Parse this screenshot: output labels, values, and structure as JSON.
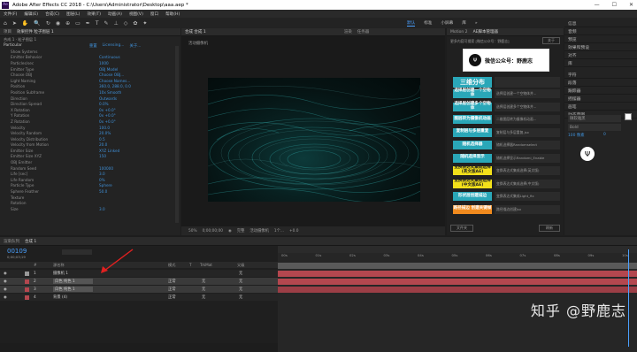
{
  "window": {
    "title": "Adobe After Effects CC 2018 - C:\\Users\\Administrator\\Desktop\\aaa.aep *",
    "logo": "Ae",
    "controls": [
      "—",
      "☐",
      "✕"
    ]
  },
  "menu": [
    "文件(F)",
    "编辑(E)",
    "合成(C)",
    "图层(L)",
    "效果(T)",
    "动画(A)",
    "视图(V)",
    "窗口",
    "帮助(H)"
  ],
  "workspaces": [
    "默认",
    "标准",
    "小屏幕",
    "库",
    "»"
  ],
  "effects_panel": {
    "tab_project": "项目",
    "tab_effects": "效果控件 粒子图层 1",
    "header": "合成 1 · 粒子图层 1",
    "effect_name": "Particular",
    "effect_links": [
      "重置",
      "Licensing...",
      "关于..."
    ],
    "props": [
      {
        "name": "Show Systems",
        "val": ""
      },
      {
        "name": "Emitter Behavior",
        "val": "Continuous"
      },
      {
        "name": "Particles/sec",
        "val": "1000"
      },
      {
        "name": "Emitter Type",
        "val": "OBJ Model"
      },
      {
        "name": "Choose OBJ",
        "val": "Choose OBJ..."
      },
      {
        "name": "Light Naming",
        "val": "Choose Names..."
      },
      {
        "name": "Position",
        "val": "360.0, 288.0, 0.0"
      },
      {
        "name": "Position Subframe",
        "val": "10x Smooth"
      },
      {
        "name": "Direction",
        "val": "Outwards"
      },
      {
        "name": "Direction Spread",
        "val": "0.0%"
      },
      {
        "name": "X Rotation",
        "val": "0x +0.0°"
      },
      {
        "name": "Y Rotation",
        "val": "0x +0.0°"
      },
      {
        "name": "Z Rotation",
        "val": "0x +0.0°"
      },
      {
        "name": "Velocity",
        "val": "100.0"
      },
      {
        "name": "Velocity Random",
        "val": "20.0%"
      },
      {
        "name": "Velocity Distribution",
        "val": "0.5"
      },
      {
        "name": "Velocity from Motion",
        "val": "20.0"
      },
      {
        "name": "Emitter Size",
        "val": "XYZ Linked"
      },
      {
        "name": "Emitter Size XYZ",
        "val": "150"
      },
      {
        "name": "OBJ Emitter",
        "val": ""
      },
      {
        "name": "Random Seed",
        "val": "100000"
      },
      {
        "name": "Life [sec]",
        "val": "3.0"
      },
      {
        "name": "Life Random",
        "val": "0%"
      },
      {
        "name": "Particle Type",
        "val": "Sphere"
      },
      {
        "name": "Sphere Feather",
        "val": "50.0"
      },
      {
        "name": "Texture",
        "val": ""
      },
      {
        "name": "Rotation",
        "val": ""
      },
      {
        "name": "Size",
        "val": "3.0"
      }
    ]
  },
  "comp_panel": {
    "tab": "合成 合成 1",
    "tab_extra": [
      "渲染",
      "任务器"
    ],
    "label": "活动摄像机",
    "footer": [
      "50%",
      "0;00;00;00",
      "完整",
      "活动摄像机",
      "1个...",
      "+0.0"
    ]
  },
  "plugin_panel": {
    "tab1": "Motion 2",
    "tab2": "AE脚本管理器",
    "header": "更多内容可搜索 [微信公众号：野鹿志]",
    "about": "关于",
    "wechat_label": "微信公众号：野鹿志",
    "title_btn": "三维分布",
    "items": [
      {
        "label": "选择层创建一个空物体",
        "desc": "选择层创建一个空物体并...",
        "color": "#2aa7b8"
      },
      {
        "label": "选择层创建多个空物体",
        "desc": "选择层创建多个空物体并...",
        "color": "#2aa7b8"
      },
      {
        "label": "图层转为摄像机动画",
        "desc": "二维图层转为摄像机动画...",
        "color": "#2aa7b8"
      },
      {
        "label": "复制层与多层重复",
        "desc": "复制层与多层重复.jsx",
        "color": "#2aa7b8"
      },
      {
        "label": "随机选择器",
        "desc": "随机选择器Randomselect",
        "color": "#2aa7b8"
      },
      {
        "label": "随机选择显示",
        "desc": "随机选择显示Randomi_Enable",
        "color": "#2aa7b8"
      },
      {
        "label": "变换表达式集成选择(英文版AE)",
        "desc": "变换表达式集成选择(英文版)",
        "color": "#f2e01a"
      },
      {
        "label": "变换表达式集成选择(中文版AE)",
        "desc": "变换表达式集成选择(中文版)",
        "color": "#f2e01a"
      },
      {
        "label": "形状层创建描边",
        "desc": "变换表达式集成Light_fix",
        "color": "#2aa7b8"
      },
      {
        "label": "路径描边 创建关键帧",
        "desc": "路径描边创建jsx",
        "color": "#f08a1e"
      }
    ],
    "footer_left": "文件夹",
    "footer_right": "刷新"
  },
  "right_panel": {
    "items": [
      "信息",
      "音频",
      "预览",
      "效果和预设",
      "对齐",
      "库",
      "字符",
      "段落",
      "跟踪器",
      "摇摆器",
      "画笔",
      "动态草图"
    ],
    "font": "微软雅黑",
    "font_style": "Bold",
    "font_size": "100 像素",
    "tracking": "0"
  },
  "timeline": {
    "tab_render": "渲染队列",
    "tab_comp": "合成 1",
    "timecode": "00109",
    "time_display": "0;00;03;19",
    "columns": [
      "#",
      "源名称",
      "模式",
      "T",
      "TrkMat",
      "父级"
    ],
    "layers": [
      {
        "num": "1",
        "name": "摄像机 1",
        "mode": "",
        "trk": "",
        "parent": "无"
      },
      {
        "num": "2",
        "name": "白色 纯色 1",
        "mode": "正常",
        "trk": "无",
        "parent": "无"
      },
      {
        "num": "3",
        "name": "白色 纯色 1",
        "mode": "正常",
        "trk": "无",
        "parent": "无"
      },
      {
        "num": "4",
        "name": "背景 (4)",
        "mode": "正常",
        "trk": "无",
        "parent": "无"
      }
    ],
    "ruler": [
      "00s",
      "01s",
      "02s",
      "03s",
      "04s",
      "05s",
      "06s",
      "07s",
      "08s",
      "09s",
      "10s"
    ]
  },
  "watermark": "知乎 @野鹿志",
  "colors": {
    "accent_blue": "#4aa0ff",
    "layer_red": "#b4474f",
    "track_red": "#9c3e46",
    "teal_btn": "#2aa7b8",
    "yellow_btn": "#f2e01a",
    "orange_btn": "#f08a1e"
  }
}
